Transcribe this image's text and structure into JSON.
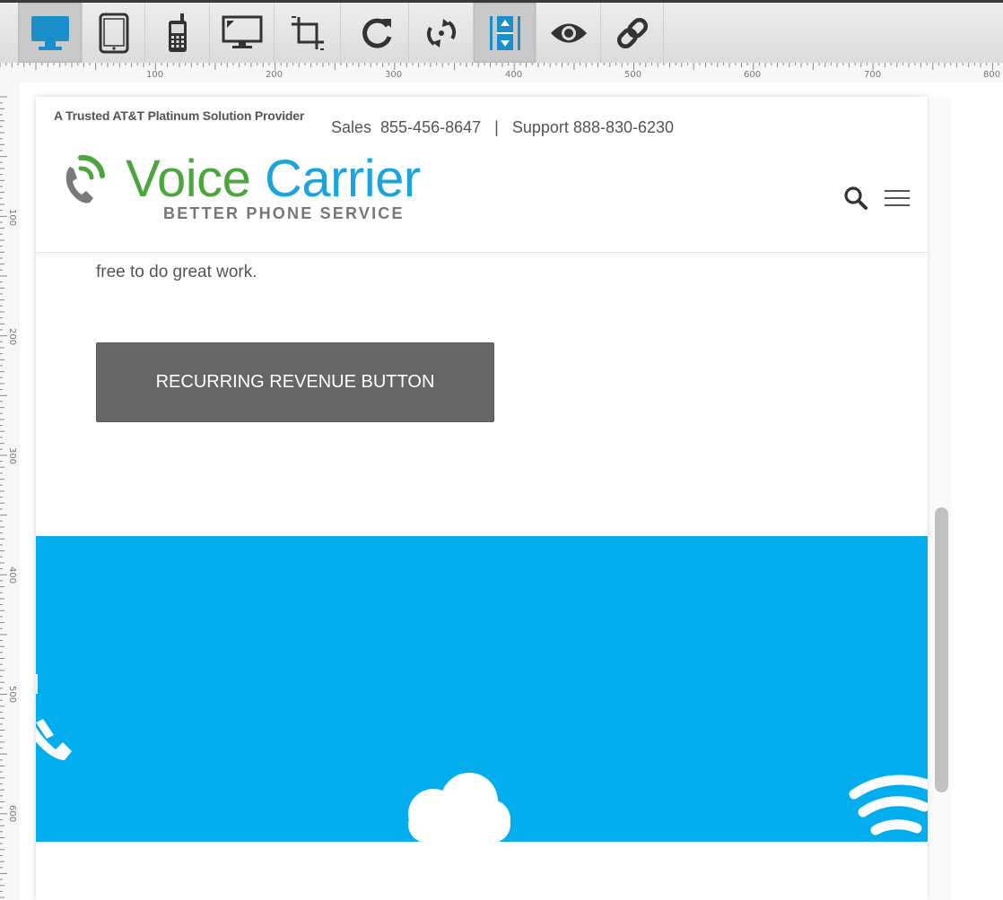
{
  "toolbar": {
    "tools": [
      {
        "name": "desktop-view-icon",
        "active": true
      },
      {
        "name": "tablet-view-icon",
        "active": false
      },
      {
        "name": "phone-view-icon",
        "active": false
      },
      {
        "name": "monitor-view-icon",
        "active": false
      },
      {
        "name": "crop-icon",
        "active": false
      },
      {
        "name": "refresh-icon",
        "active": false
      },
      {
        "name": "rotate-icon",
        "active": false
      },
      {
        "name": "fit-height-icon",
        "active": true
      },
      {
        "name": "preview-eye-icon",
        "active": false
      },
      {
        "name": "link-icon",
        "active": false
      }
    ],
    "accent_color": "#1a8fc9"
  },
  "ruler": {
    "h_labels": [
      "100",
      "200",
      "300",
      "400",
      "500",
      "600",
      "700",
      "800"
    ],
    "v_labels": [
      "100",
      "200",
      "300",
      "400",
      "500",
      "600"
    ]
  },
  "site": {
    "tagline": "A Trusted AT&T Platinum Solution Provider",
    "sales": "Sales  855-456-8647",
    "separator": "|",
    "support": "Support 888-830-6230",
    "logo_word1": "Voice",
    "logo_word2": "Carrier",
    "logo_sub": "BETTER PHONE SERVICE",
    "body_text": "free to do great work.",
    "cta_label": "RECURRING REVENUE BUTTON",
    "colors": {
      "logo_green": "#4ca63d",
      "logo_blue": "#1aa5dc",
      "band_blue": "#02adee",
      "button_gray": "#666666"
    },
    "band_icons": [
      "phone-icon",
      "cloud-icon",
      "wifi-icon"
    ]
  }
}
